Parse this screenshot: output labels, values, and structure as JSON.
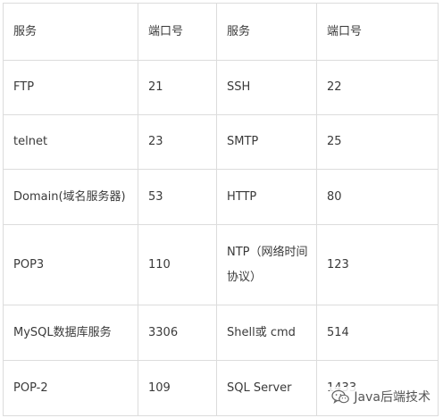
{
  "table": {
    "header": [
      "服务",
      "端口号",
      "服务",
      "端口号"
    ],
    "rows": [
      [
        "FTP",
        "21",
        "SSH",
        "22"
      ],
      [
        "telnet",
        "23",
        "SMTP",
        "25"
      ],
      [
        "Domain(域名服务器)",
        "53",
        "HTTP",
        "80"
      ],
      [
        "POP3",
        "110",
        "NTP（网络时间协议）",
        "123"
      ],
      [
        "MySQL数据库服务",
        "3306",
        "Shell或 cmd",
        "514"
      ],
      [
        "POP-2",
        "109",
        "SQL Server",
        "1433"
      ]
    ]
  },
  "watermark": {
    "icon": "wechat-icon",
    "text": "Java后端技术"
  }
}
